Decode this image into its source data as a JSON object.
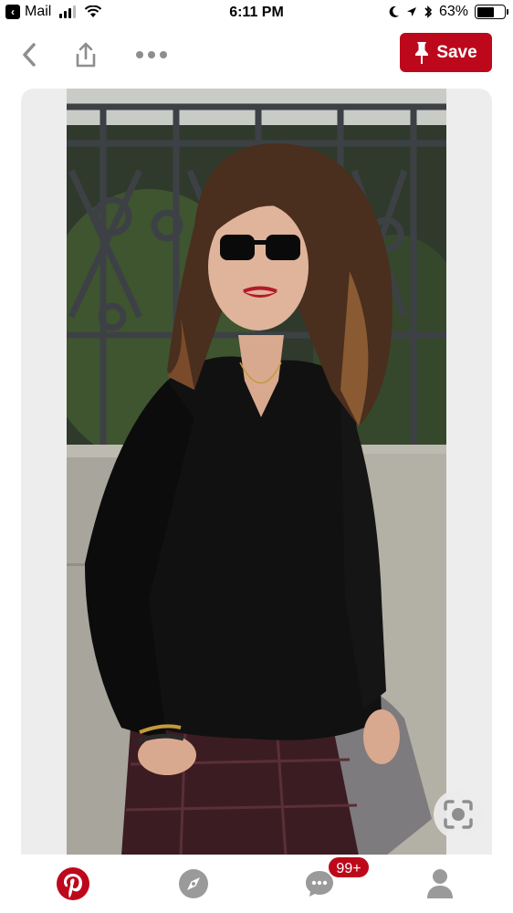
{
  "status_bar": {
    "back_app": "Mail",
    "time": "6:11 PM",
    "battery": "63%",
    "battery_level": 0.63
  },
  "toolbar": {
    "save_label": "Save"
  },
  "tab_bar": {
    "messages_badge": "99+"
  },
  "colors": {
    "brand": "#bd081c",
    "card_background": "#ededed",
    "icon_gray": "#9a9a9a"
  },
  "icons": {
    "back": "chevron-left-icon",
    "share": "share-icon",
    "more": "more-dots-icon",
    "save": "pin-icon",
    "visual_search": "visual-search-icon",
    "home": "pinterest-logo-icon",
    "explore": "compass-icon",
    "messages": "chat-bubble-icon",
    "profile": "person-icon"
  }
}
